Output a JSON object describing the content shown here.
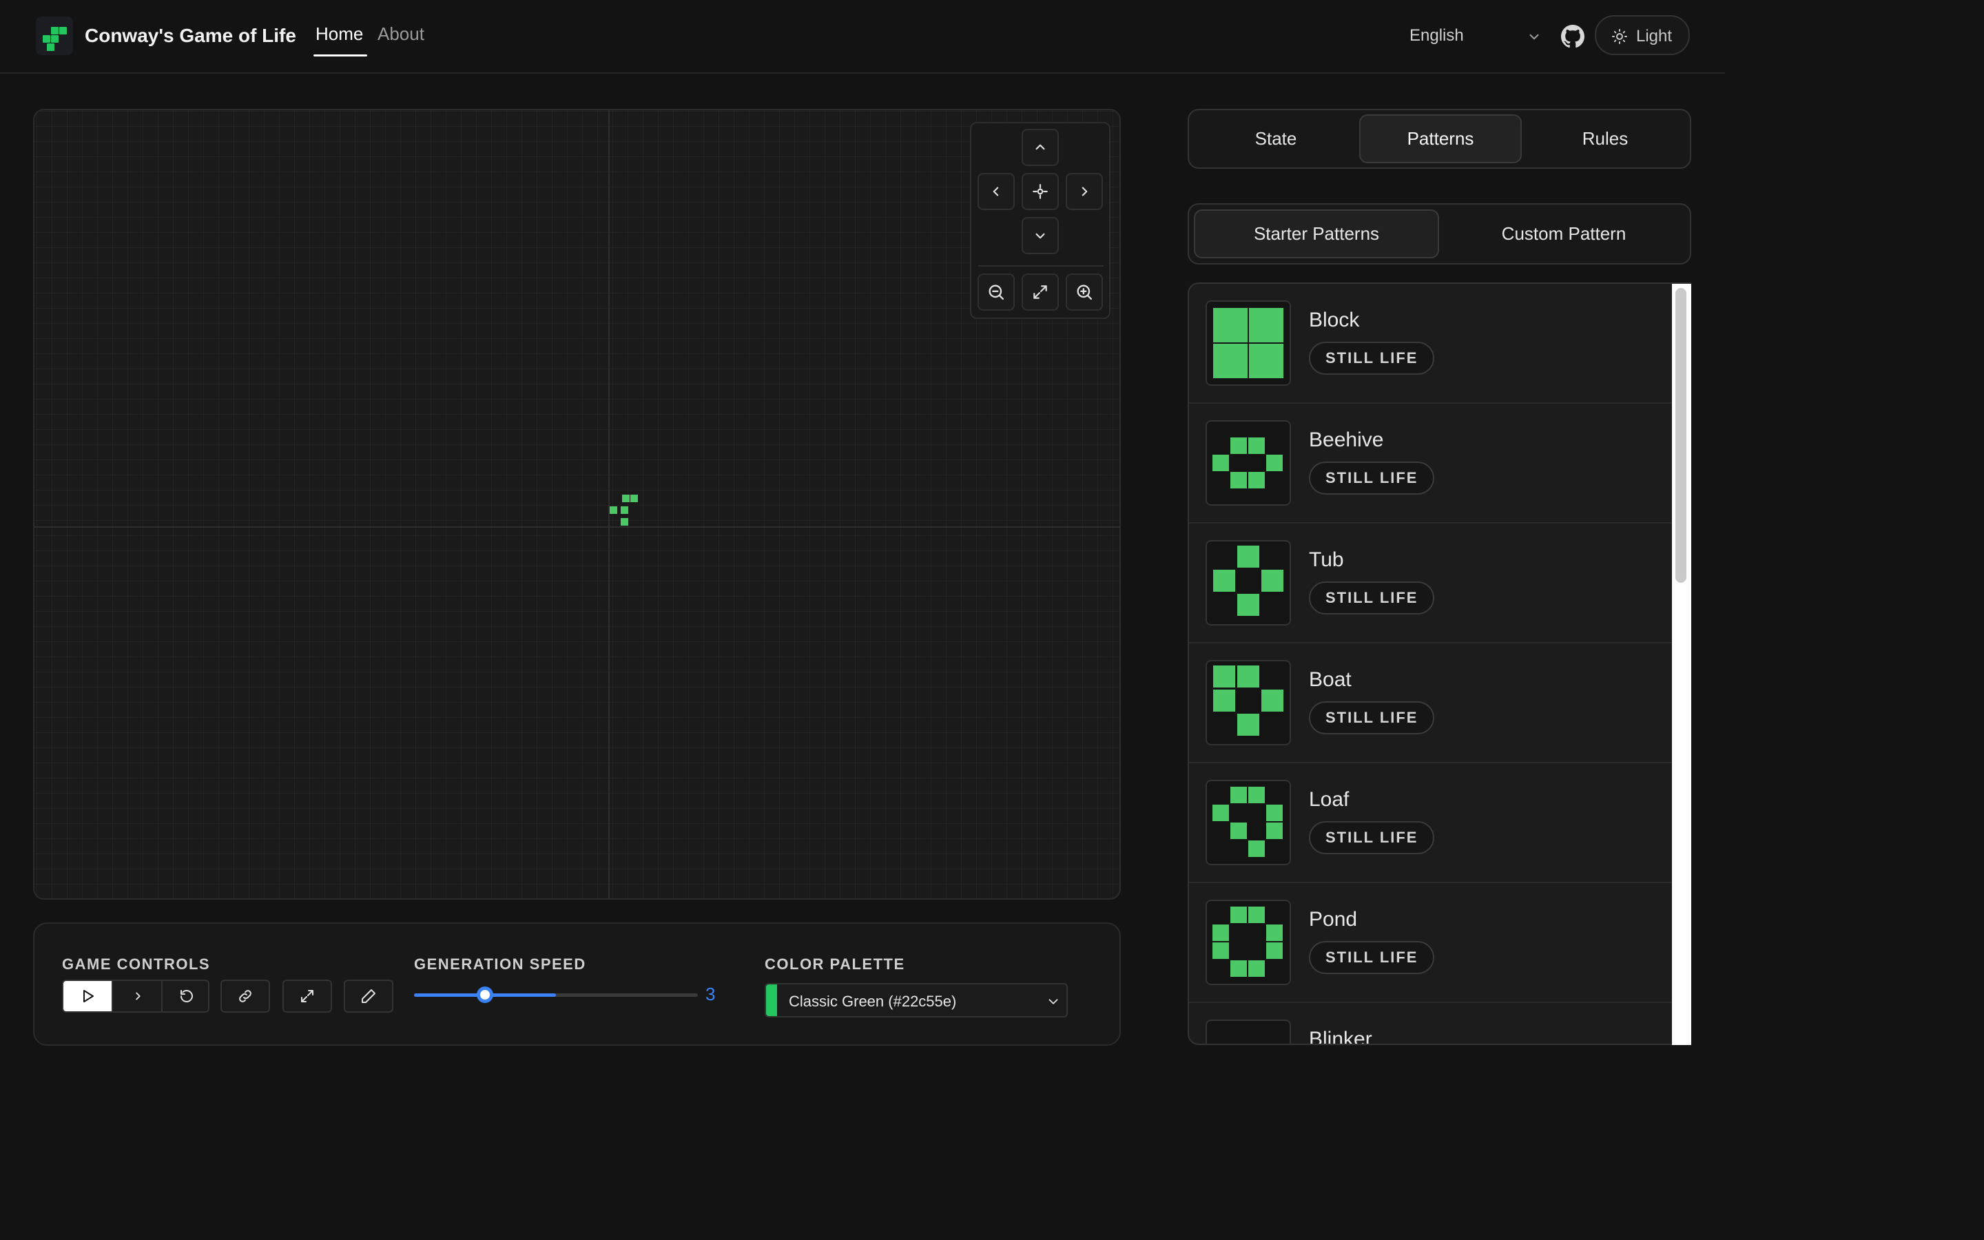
{
  "header": {
    "app_title": "Conway's Game of Life",
    "nav": [
      {
        "label": "Home",
        "active": true
      },
      {
        "label": "About",
        "active": false
      }
    ],
    "language": "English",
    "theme_toggle_label": "Light",
    "icons": {
      "logo": "glider-logo-icon",
      "github": "github-icon",
      "theme": "sun-icon"
    }
  },
  "canvas": {
    "navigation_controls": [
      "pan-up",
      "pan-left",
      "center",
      "pan-right",
      "pan-down",
      "zoom-out",
      "fit-to-screen",
      "zoom-in"
    ]
  },
  "controls": {
    "game_controls_label": "GAME CONTROLS",
    "game_buttons": [
      "play",
      "step",
      "reset",
      "share-link",
      "fullscreen",
      "draw"
    ],
    "generation_speed_label": "GENERATION SPEED",
    "generation_speed_value": "3",
    "speed_fraction": 0.25,
    "color_palette_label": "COLOR PALETTE",
    "color_palette_value": "Classic Green (#22c55e)",
    "palette_color": "#22c55e"
  },
  "sidebar": {
    "tabs": [
      {
        "label": "State",
        "active": false
      },
      {
        "label": "Patterns",
        "active": true
      },
      {
        "label": "Rules",
        "active": false
      }
    ],
    "subtabs": [
      {
        "label": "Starter Patterns",
        "active": true
      },
      {
        "label": "Custom Pattern",
        "active": false
      }
    ],
    "patterns": [
      {
        "name": "Block",
        "category": "STILL LIFE"
      },
      {
        "name": "Beehive",
        "category": "STILL LIFE"
      },
      {
        "name": "Tub",
        "category": "STILL LIFE"
      },
      {
        "name": "Boat",
        "category": "STILL LIFE"
      },
      {
        "name": "Loaf",
        "category": "STILL LIFE"
      },
      {
        "name": "Pond",
        "category": "STILL LIFE"
      },
      {
        "name": "Blinker",
        "category": ""
      }
    ]
  },
  "colors": {
    "accent": "#3b82f6",
    "cell": "#4cc866",
    "background": "#131313"
  }
}
